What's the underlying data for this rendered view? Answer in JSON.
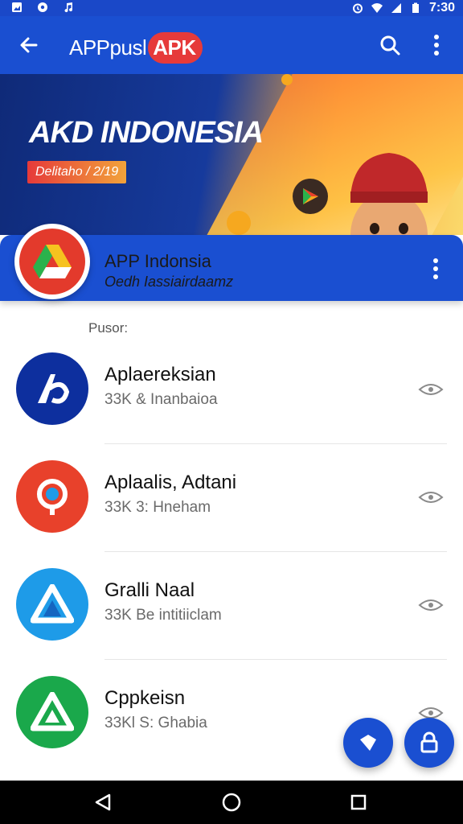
{
  "status_bar": {
    "time": "7:30",
    "icons": [
      "image-icon",
      "record-icon",
      "music-icon",
      "alarm-icon",
      "wifi-icon",
      "signal-icon",
      "battery-icon"
    ]
  },
  "app_bar": {
    "title_prefix": "APPpusl",
    "title_badge": "APK",
    "back_icon": "arrow-left-icon",
    "search_icon": "search-icon",
    "more_icon": "more-vert-icon"
  },
  "banner": {
    "title": "AKD INDONESIA",
    "tag": "Delitaho / 2/19"
  },
  "featured": {
    "name": "APP Indonsia",
    "subtitle": "Oedh Iassiairdaamz"
  },
  "section_label": "Pusor:",
  "apps": [
    {
      "name": "Aplaereksian",
      "meta": "33K & Inanbaioa",
      "color": "#0d2f9e",
      "icon": "app-logo-icon"
    },
    {
      "name": "Aplaalis, Adtani",
      "meta": "33K  3: Hneham",
      "color": "#e8412b",
      "icon": "app-logo-icon"
    },
    {
      "name": "Gralli Naal",
      "meta": "33K  Be intitiiclam",
      "color": "#1e9be8",
      "icon": "app-logo-icon"
    },
    {
      "name": "Cppkeisn",
      "meta": "33Kl  S: Ghabia",
      "color": "#1aa84b",
      "icon": "app-logo-icon"
    }
  ],
  "fabs": [
    "tag-icon",
    "lock-icon"
  ],
  "colors": {
    "primary": "#1a4fd1",
    "accent": "#e63a3a"
  }
}
